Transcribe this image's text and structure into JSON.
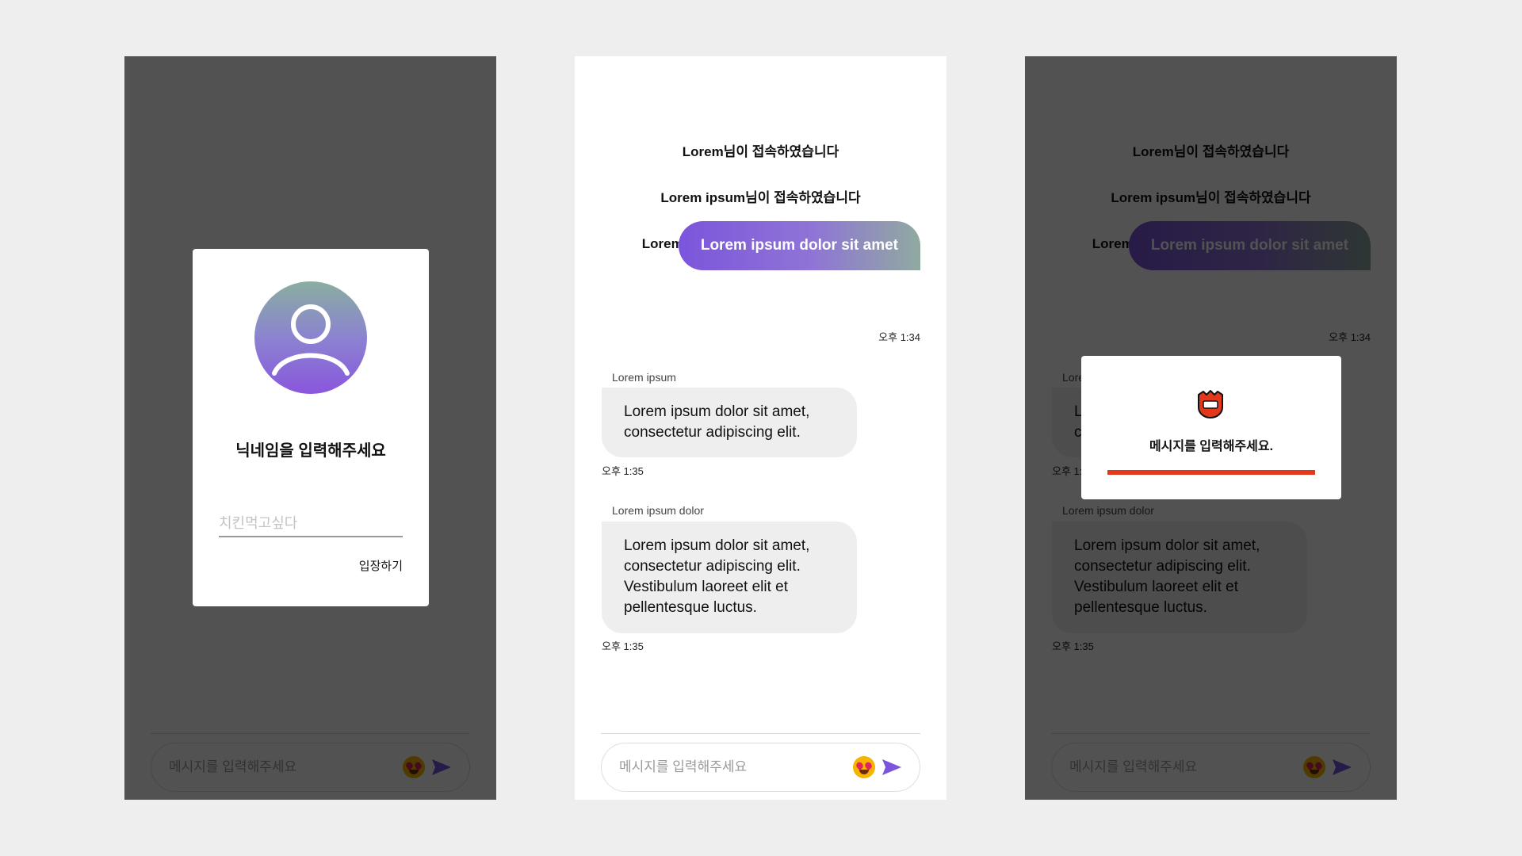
{
  "colors": {
    "accent_purple": "#7b55dc",
    "accent_teal": "#90aaa0",
    "alert_red": "#e2391c",
    "overlay": "#4d4d4d"
  },
  "nickname_modal": {
    "title": "닉네임을 입력해주세요",
    "input_placeholder": "치킨먹고싶다",
    "enter_button": "입장하기",
    "avatar_icon": "user-icon"
  },
  "chat": {
    "system_messages": [
      "Lorem님이 접속하였습니다",
      "Lorem ipsum님이 접속하였습니다",
      "Lorem ipsum dolor님이 접속하였습니다"
    ],
    "my_message": {
      "text": "Lorem ipsum dolor sit amet",
      "time": "오후 1:34"
    },
    "others": [
      {
        "sender": "Lorem ipsum",
        "line1": "Lorem ipsum dolor sit amet,",
        "line2": "consectetur adipiscing elit.",
        "time": "오후 1:35"
      },
      {
        "sender": "Lorem ipsum dolor",
        "line1": "Lorem ipsum dolor sit amet,",
        "line2": "consectetur adipiscing elit.",
        "line3": "Vestibulum laoreet elit et",
        "line4": "pellentesque luctus.",
        "time": "오후 1:35"
      }
    ]
  },
  "input": {
    "placeholder": "메시지를 입력해주세요",
    "emoji_icon": "heart-eyes-emoji-icon",
    "send_icon": "send-arrow-icon"
  },
  "alert": {
    "text": "메시지를 입력해주세요.",
    "icon": "angry-face-icon"
  }
}
